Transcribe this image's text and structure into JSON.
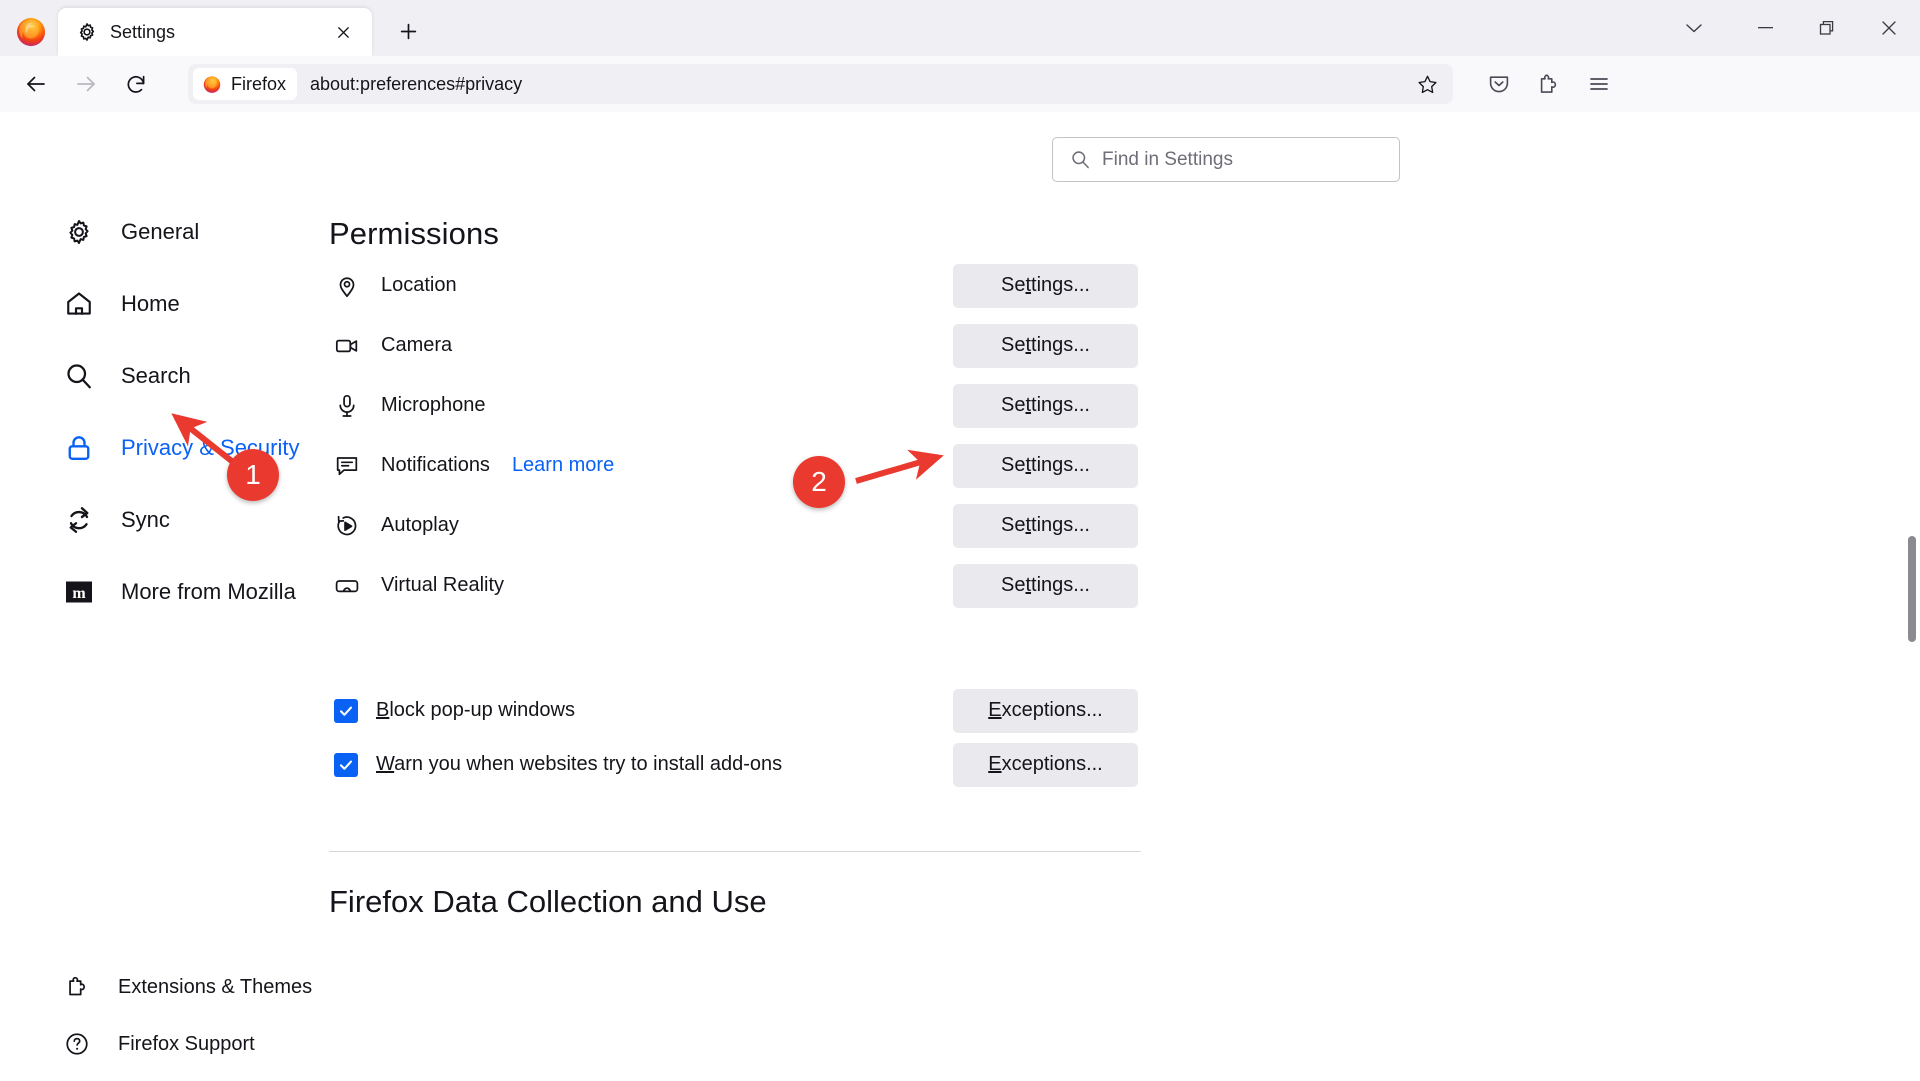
{
  "window": {
    "controls": [
      {
        "name": "list-all-tabs",
        "icon": "chevron-down-icon"
      },
      {
        "name": "minimize",
        "icon": "minimize-icon"
      },
      {
        "name": "restore",
        "icon": "restore-icon"
      },
      {
        "name": "close",
        "icon": "close-icon"
      }
    ]
  },
  "tabbar": {
    "tab": {
      "title": "Settings",
      "favicon": "gear-icon",
      "close_label": "×"
    },
    "new_tab_label": "+"
  },
  "toolbar": {
    "back_icon": "back-arrow-icon",
    "forward_icon": "forward-arrow-icon",
    "reload_icon": "reload-icon",
    "urlbar": {
      "chip_label": "Firefox",
      "chip_icon": "firefox-logo-icon",
      "url": "about:preferences#privacy",
      "bookmark_icon": "star-icon"
    },
    "right_icons": [
      {
        "name": "pocket-save-icon"
      },
      {
        "name": "extensions-puzzle-icon"
      },
      {
        "name": "application-menu-icon"
      }
    ]
  },
  "search": {
    "placeholder": "Find in Settings",
    "value": "",
    "icon": "search-icon"
  },
  "sidebar": {
    "items": [
      {
        "label": "General",
        "icon": "gear-icon",
        "selected": false
      },
      {
        "label": "Home",
        "icon": "home-icon",
        "selected": false
      },
      {
        "label": "Search",
        "icon": "search-icon",
        "selected": false
      },
      {
        "label": "Privacy & Security",
        "icon": "lock-icon",
        "selected": true
      },
      {
        "label": "Sync",
        "icon": "sync-icon",
        "selected": false
      },
      {
        "label": "More from Mozilla",
        "icon": "mozilla-m-icon",
        "selected": false
      }
    ],
    "footer": [
      {
        "label": "Extensions & Themes",
        "icon": "puzzle-icon"
      },
      {
        "label": "Firefox Support",
        "icon": "question-circle-icon"
      }
    ]
  },
  "main": {
    "section_title": "Permissions",
    "permissions": [
      {
        "label": "Location",
        "icon": "location-pin-icon",
        "button": "Settings...",
        "access_key": "t",
        "link": ""
      },
      {
        "label": "Camera",
        "icon": "camera-icon",
        "button": "Settings...",
        "access_key": "t",
        "link": ""
      },
      {
        "label": "Microphone",
        "icon": "microphone-icon",
        "button": "Settings...",
        "access_key": "t",
        "link": ""
      },
      {
        "label": "Notifications",
        "icon": "notification-icon",
        "button": "Settings...",
        "access_key": "t",
        "link": "Learn more"
      },
      {
        "label": "Autoplay",
        "icon": "autoplay-icon",
        "button": "Settings...",
        "access_key": "t",
        "link": ""
      },
      {
        "label": "Virtual Reality",
        "icon": "vr-headset-icon",
        "button": "Settings...",
        "access_key": "t",
        "link": ""
      }
    ],
    "checkboxes": [
      {
        "label_pre": "",
        "label_key": "B",
        "label_post": "lock pop-up windows",
        "checked": true,
        "button": "Exceptions...",
        "btn_key": "E",
        "btn_post": "xceptions..."
      },
      {
        "label_pre": "",
        "label_key": "W",
        "label_post": "arn you when websites try to install add-ons",
        "checked": true,
        "button": "Exceptions...",
        "btn_key": "E",
        "btn_post": "xceptions..."
      }
    ],
    "bottom_heading": "Firefox Data Collection and Use"
  },
  "annotations": [
    {
      "number": "1",
      "target": "Privacy & Security sidebar item"
    },
    {
      "number": "2",
      "target": "Notifications Settings button"
    }
  ],
  "colors": {
    "accent_blue": "#0a62f5",
    "annotation_red": "#ea3a30",
    "button_grey": "#eaeaee",
    "chrome_grey": "#f0f0f4",
    "nav_grey": "#f9f9fb"
  }
}
